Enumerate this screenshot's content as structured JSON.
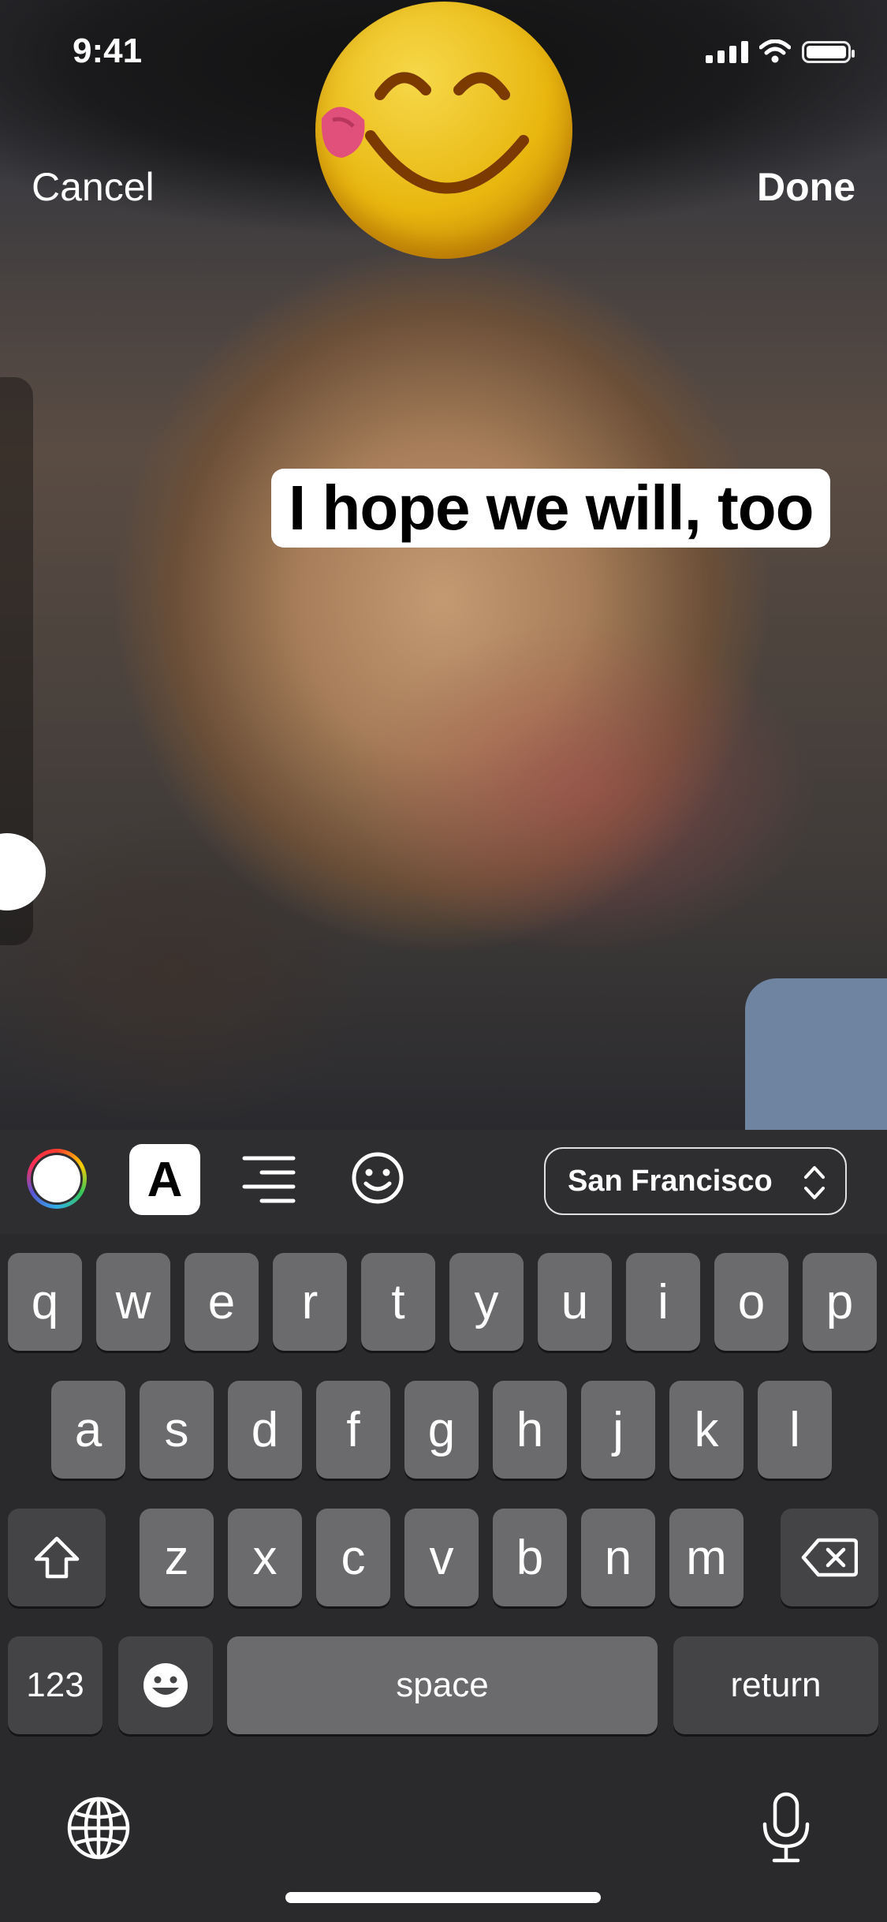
{
  "status_bar": {
    "time": "9:41"
  },
  "nav": {
    "cancel_label": "Cancel",
    "done_label": "Done"
  },
  "stickers": {
    "emoji": "savoring-food-emoji",
    "text": "I hope we will, too"
  },
  "toolbar": {
    "font_name": "San Francisco",
    "text_style_letter": "A"
  },
  "keyboard": {
    "row1": [
      "q",
      "w",
      "e",
      "r",
      "t",
      "y",
      "u",
      "i",
      "o",
      "p"
    ],
    "row2": [
      "a",
      "s",
      "d",
      "f",
      "g",
      "h",
      "j",
      "k",
      "l"
    ],
    "row3": [
      "z",
      "x",
      "c",
      "v",
      "b",
      "n",
      "m"
    ],
    "numbers_label": "123",
    "space_label": "space",
    "return_label": "return"
  },
  "icons": [
    "signal-icon",
    "wifi-icon",
    "battery-icon",
    "color-wheel-icon",
    "align-right-icon",
    "smiley-icon",
    "chevron-up-down-icon",
    "shift-icon",
    "delete-icon",
    "globe-icon",
    "microphone-icon"
  ]
}
